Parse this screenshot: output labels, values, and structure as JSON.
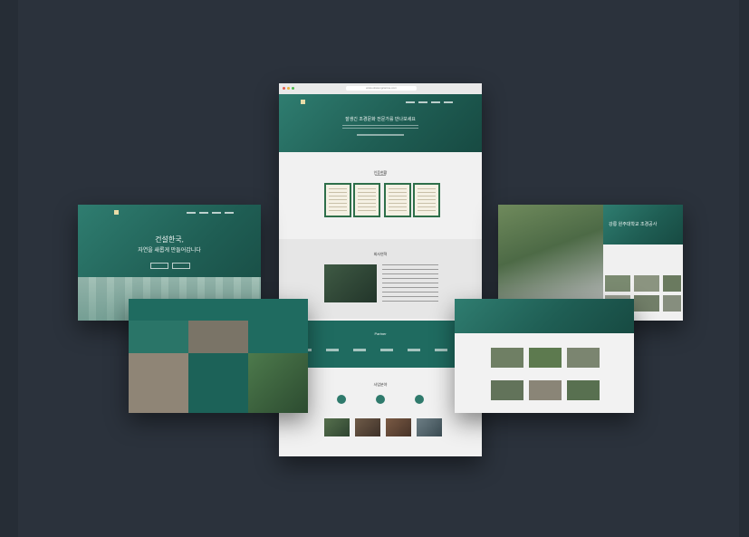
{
  "browser": {
    "url": "www.okssungcanine.com"
  },
  "center": {
    "hero_title": "잘생긴 조경문화 전문가를 만나보세요",
    "cert_section_title": "인증현황",
    "cert_captions": [
      "",
      "",
      "",
      ""
    ],
    "history_title": "회사연혁",
    "partners_title": "Partner",
    "business_title": "사업분야",
    "bottom_captions": [
      "",
      "",
      "",
      ""
    ]
  },
  "left_top": {
    "headline_line1": "건설한국,",
    "headline_line2": "자연을 새롭게 만들어갑니다"
  },
  "left_bottom": {
    "tiles": [
      "",
      "",
      "",
      "",
      ""
    ]
  },
  "right_top": {
    "title": "강릉 원주대학교 조경공사"
  },
  "colors": {
    "background": "#2b323c",
    "primary_green": "#1f6b60",
    "light_panel": "#efefef"
  }
}
